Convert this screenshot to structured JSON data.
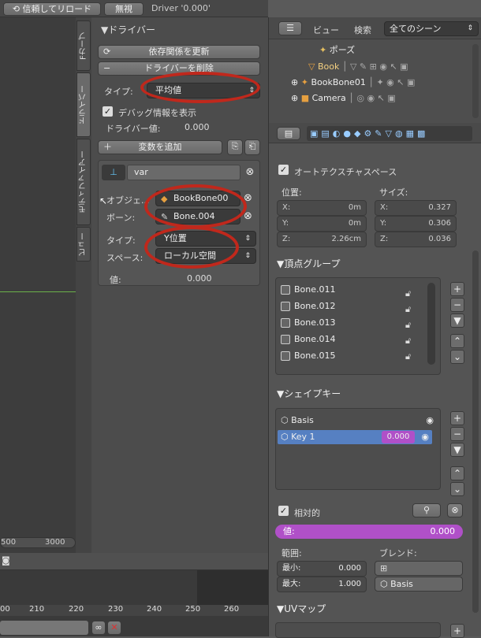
{
  "topbar": {
    "reload_label": "信頼してリロード",
    "disable_label": "無視",
    "driver_name": "Driver '0.000'"
  },
  "vtabs": {
    "fcurve": "Fカーブ",
    "drivers": "ドライバー",
    "modifiers": "モディファイアー",
    "view": "ビュー"
  },
  "driver_panel": {
    "header": "▼ドライバー",
    "update_deps": "依存関係を更新",
    "remove_driver": "ドライバーを削除",
    "type_label": "タイプ:",
    "type_value": "平均値",
    "show_debug": "デバッグ情報を表示",
    "driver_value_label": "ドライバー値:",
    "driver_value": "0.000",
    "add_variable": "変数を追加",
    "var_name": "var",
    "object_label": "オブジェ...",
    "object_value": "BookBone00",
    "bone_label": "ボーン:",
    "bone_value": "Bone.004",
    "var_type_label": "タイプ:",
    "var_type_value": "Y位置",
    "space_label": "スペース:",
    "space_value": "ローカル空間",
    "value_label": "値:",
    "value_value": "0.000"
  },
  "bottom": {
    "axis_left": "500",
    "axis_right": "3000",
    "frames": [
      "00",
      "210",
      "220",
      "230",
      "240",
      "250",
      "260"
    ]
  },
  "outliner": {
    "view": "ビュー",
    "search": "検索",
    "scene_select": "全てのシーン",
    "items": [
      "ポーズ",
      "Book",
      "BookBone01",
      "Camera"
    ]
  },
  "props": {
    "auto_tex": "オートテクスチャスペース",
    "location_label": "位置:",
    "size_label": "サイズ:",
    "loc": [
      {
        "axis": "X:",
        "val": "0m"
      },
      {
        "axis": "Y:",
        "val": "0m"
      },
      {
        "axis": "Z:",
        "val": "2.26cm"
      }
    ],
    "size": [
      {
        "axis": "X:",
        "val": "0.327"
      },
      {
        "axis": "Y:",
        "val": "0.306"
      },
      {
        "axis": "Z:",
        "val": "0.036"
      }
    ],
    "vertex_groups_header": "▼頂点グループ",
    "vertex_groups": [
      "Bone.011",
      "Bone.012",
      "Bone.013",
      "Bone.014",
      "Bone.015"
    ],
    "shape_keys_header": "▼シェイプキー",
    "shape_keys": [
      {
        "name": "Basis",
        "value": ""
      },
      {
        "name": "Key 1",
        "value": "0.000"
      }
    ],
    "relative": "相対的",
    "value_label": "値:",
    "value": "0.000",
    "range_label": "範囲:",
    "blend_label": "ブレンド:",
    "min_label": "最小:",
    "min_val": "0.000",
    "max_label": "最大:",
    "max_val": "1.000",
    "blend_value": "Basis",
    "uv_header": "▼UVマップ"
  }
}
